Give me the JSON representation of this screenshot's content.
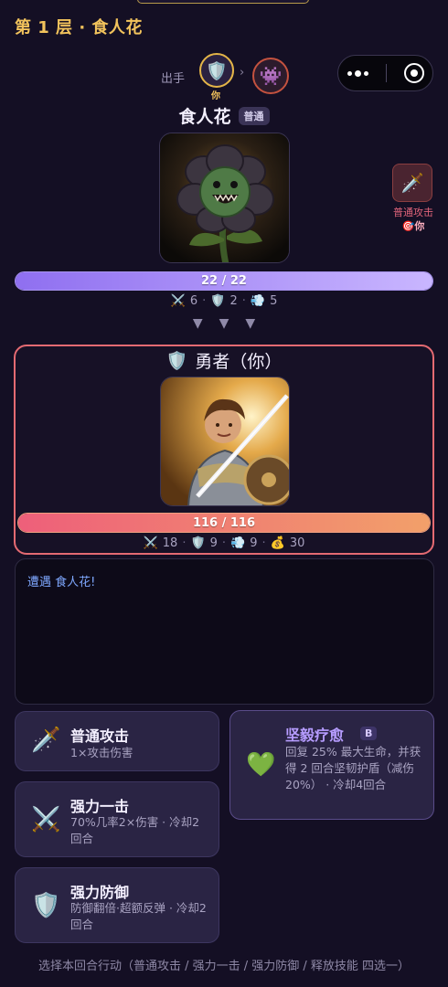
{
  "header": {
    "floor_title": "第 1 层 · 食人花"
  },
  "turn_order": {
    "label": "出手",
    "you_tag": "你",
    "arrow": "›"
  },
  "enemy": {
    "name": "食人花",
    "rank": "普通",
    "hp_text": "22 / 22",
    "hp_fraction": 1.0,
    "stats": {
      "atk": "6",
      "def": "2",
      "spd": "5"
    },
    "intent": {
      "label": "普通攻击",
      "target": "🎯你"
    }
  },
  "divider_arrows": [
    "▼",
    "▼",
    "▼"
  ],
  "hero": {
    "name": "勇者（你）",
    "hp_text": "116 / 116",
    "hp_fraction": 1.0,
    "stats": {
      "atk": "18",
      "def": "9",
      "spd": "9",
      "gold": "30"
    }
  },
  "log": {
    "lines": [
      "遭遇 食人花!"
    ]
  },
  "actions": {
    "attack": {
      "title": "普通攻击",
      "desc": "1×攻击伤害"
    },
    "strong": {
      "title": "强力一击",
      "desc": "70%几率2×伤害 · 冷却2回合"
    },
    "defend": {
      "title": "强力防御",
      "desc": "防御翻倍·超额反弹 · 冷却2回合"
    },
    "skill": {
      "title": "坚毅疗愈",
      "grade": "B",
      "desc": "回复 25% 最大生命，并获得 2 回合坚韧护盾（减伤 20%） · 冷却4回合"
    }
  },
  "hint": "选择本回合行动（普通攻击 / 强力一击 / 强力防御 / 释放技能 四选一）",
  "icons": {
    "shield": "🛡️",
    "monster": "👾",
    "sword": "🗡️",
    "crossed_swords": "⚔️",
    "speed": "💨",
    "gold": "💰",
    "heart": "💚"
  },
  "colors": {
    "accent_gold": "#f2c35c",
    "hero_border": "#e46a72",
    "enemy_hp": "#8f6ff0",
    "hero_hp": "#ee5f7a",
    "skill_title": "#b69cff"
  }
}
